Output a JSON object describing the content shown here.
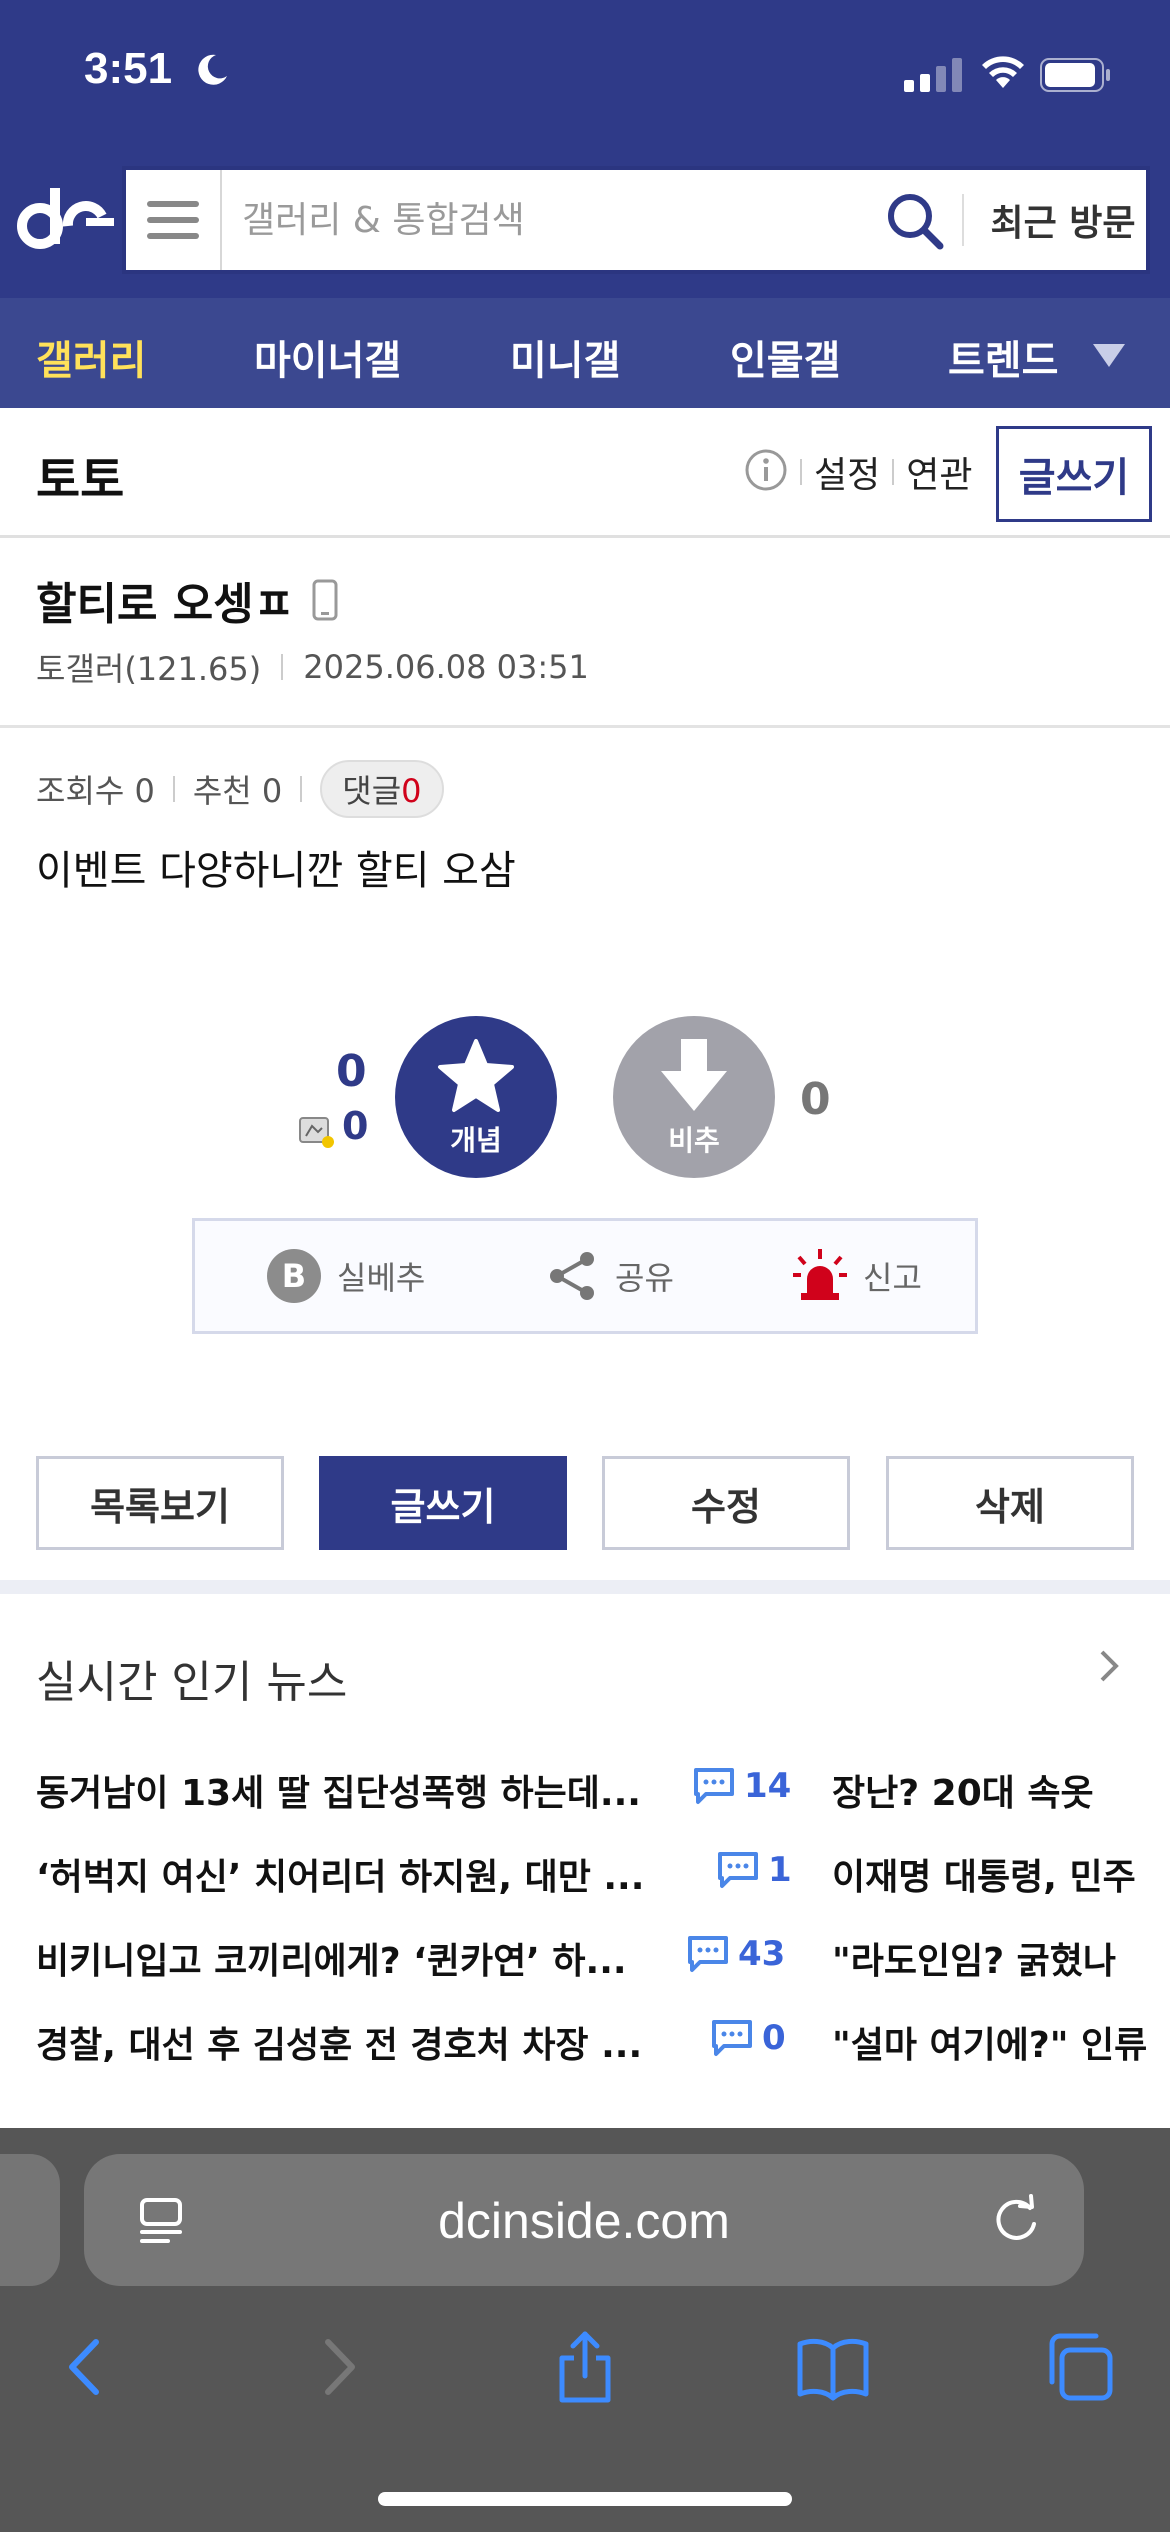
{
  "status": {
    "time": "3:51"
  },
  "header": {
    "search_placeholder": "갤러리 & 통합검색",
    "recent_label": "최근 방문"
  },
  "gallery_nav": {
    "items": [
      "갤러리",
      "마이너갤",
      "미니갤",
      "인물갤",
      "트렌드"
    ],
    "active_index": 0
  },
  "gallery": {
    "title": "토토",
    "settings_label": "설정",
    "related_label": "연관",
    "write_label": "글쓰기"
  },
  "post": {
    "title": "할티로 오셍ㅍ",
    "author": "토갤러(121.65)",
    "date": "2025.06.08 03:51",
    "views_label": "조회수 0",
    "recommend_label": "추천 0",
    "comment_label": "댓글",
    "comment_count": "0",
    "body": "이벤트 다양하니깐 할티 오삼"
  },
  "votes": {
    "up_count": "0",
    "fix_count": "0",
    "up_label": "개념",
    "down_label": "비추",
    "down_count": "0"
  },
  "actions": {
    "silbe_label": "실베추",
    "share_label": "공유",
    "report_label": "신고"
  },
  "buttons": {
    "list": "목록보기",
    "write": "글쓰기",
    "edit": "수정",
    "delete": "삭제"
  },
  "news": {
    "title": "실시간 인기 뉴스",
    "items": [
      {
        "left": "동거남이 13세 딸 집단성폭행 하는데...",
        "count": "14",
        "right": "장난? 20대   속옷"
      },
      {
        "left": "‘허벅지 여신’ 치어리더 하지원, 대만 ...",
        "count": "1",
        "right": "이재명 대통령, 민주"
      },
      {
        "left": "비키니입고 코끼리에게? ‘퀸카연’ 하...",
        "count": "43",
        "right": "\"라도인임? 굵혔나"
      },
      {
        "left": "경찰, 대선 후 김성훈 전 경호처 차장 ...",
        "count": "0",
        "right": "\"설마 여기에?\" 인류"
      }
    ]
  },
  "browser": {
    "url": "dcinside.com"
  },
  "colors": {
    "brand": "#2f3a88",
    "nav_active": "#ffe15a",
    "comment_count": "#3a64d8",
    "report_red": "#d0021b"
  }
}
